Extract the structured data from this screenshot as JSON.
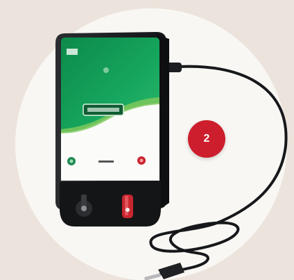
{
  "image": {
    "subject": "electric-fence-energizer",
    "brand_label": "",
    "callout_number": "2"
  },
  "colors": {
    "background": "#ece4dc",
    "circle": "#f9f7f4",
    "device_green": "#12a05a",
    "device_body": "#222427",
    "badge": "#cc1e2c",
    "terminal_red": "#c8262f"
  },
  "icons": [
    "power-led-icon",
    "fault-led-icon",
    "ground-terminal-icon",
    "fence-terminal-icon",
    "plug-icon"
  ]
}
